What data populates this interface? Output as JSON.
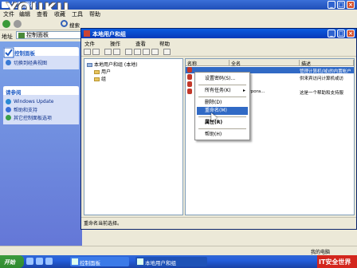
{
  "outer_window": {
    "title": "控制面板",
    "watermark": "YOUKU",
    "menu": [
      "文件",
      "编辑",
      "查看",
      "收藏",
      "工具",
      "帮助"
    ],
    "toolbar_search": "搜索",
    "address_label": "地址",
    "address_value": "控制面板"
  },
  "left_pane": {
    "panel1_title": "控制面板",
    "panel1_items": [
      "切换到经典视图"
    ],
    "panel2_title": "请参阅",
    "panel2_items": [
      "Windows Update",
      "帮助和支持",
      "其它控制面板选项"
    ]
  },
  "inner_window": {
    "title": "本地用户和组",
    "menu": [
      "文件",
      "操作",
      "查看",
      "帮助"
    ],
    "tree": {
      "root": "本地用户和组 (本地)",
      "children": [
        "用户",
        "组"
      ]
    },
    "list": {
      "columns": [
        "名称",
        "全名",
        "描述"
      ],
      "rows": [
        {
          "name": "",
          "full": "",
          "desc": "管理计算机(域)的内置帐户",
          "selected": true
        },
        {
          "name": "",
          "full": "",
          "desc": "供来宾访问计算机或访",
          "selected": false
        },
        {
          "name": "",
          "full": "",
          "desc": "",
          "selected": false
        },
        {
          "name": "",
          "full": "osoft Corpora...",
          "desc": "这是一个帮助和支持服",
          "selected": false
        }
      ]
    },
    "status": "重命名当前选择。"
  },
  "context_menu": {
    "items": [
      {
        "label": "设置密码(S)...",
        "submenu": false,
        "highlight": false
      },
      {
        "label": "所有任务(K)",
        "submenu": true,
        "highlight": false
      },
      {
        "label": "删除(D)",
        "submenu": false,
        "highlight": false
      },
      {
        "label": "重命名(M)",
        "submenu": false,
        "highlight": true
      },
      {
        "label": "属性(R)",
        "submenu": false,
        "highlight": false
      },
      {
        "label": "帮助(H)",
        "submenu": false,
        "highlight": false
      }
    ]
  },
  "outer_status": "我的电脑",
  "taskbar": {
    "start": "开始",
    "tasks": [
      {
        "label": "控制面板",
        "active": false
      },
      {
        "label": "本地用户和组",
        "active": true
      }
    ],
    "badge": "IT安全世界"
  }
}
